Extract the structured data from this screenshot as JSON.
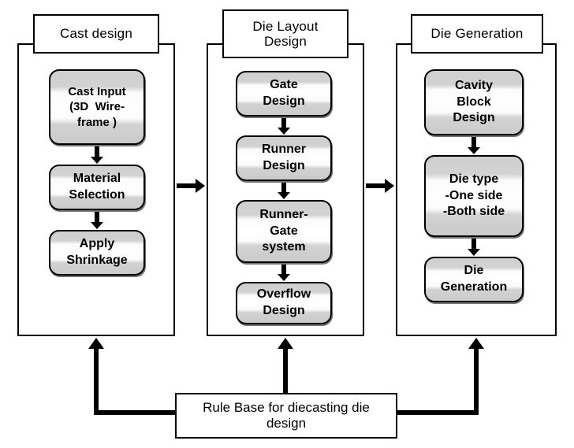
{
  "diagram": {
    "title": "Diecasting die design system flowchart",
    "phases": [
      {
        "id": "cast-design",
        "title": "Cast design",
        "steps": [
          {
            "id": "cast-input",
            "lines": [
              "Cast Input",
              "(3D  Wire-",
              "frame )"
            ]
          },
          {
            "id": "material-selection",
            "lines": [
              "Material",
              "Selection"
            ]
          },
          {
            "id": "apply-shrinkage",
            "lines": [
              "Apply",
              "Shrinkage"
            ]
          }
        ]
      },
      {
        "id": "die-layout-design",
        "title": "Die Layout\nDesign",
        "steps": [
          {
            "id": "gate-design",
            "lines": [
              "Gate",
              "Design"
            ]
          },
          {
            "id": "runner-design",
            "lines": [
              "Runner",
              "Design"
            ]
          },
          {
            "id": "runner-gate-system",
            "lines": [
              "Runner-",
              "Gate",
              "system"
            ]
          },
          {
            "id": "overflow-design",
            "lines": [
              "Overflow",
              "Design"
            ]
          }
        ]
      },
      {
        "id": "die-generation",
        "title": "Die Generation",
        "steps": [
          {
            "id": "cavity-block-design",
            "lines": [
              "Cavity",
              "Block",
              "Design"
            ]
          },
          {
            "id": "die-type",
            "lines": [
              "Die type",
              "-One side",
              "-Both side"
            ]
          },
          {
            "id": "die-generation-step",
            "lines": [
              "Die",
              "Generation"
            ]
          }
        ]
      }
    ],
    "rule_base": {
      "id": "rule-base",
      "label": "Rule Base for diecasting die\ndesign"
    },
    "colors": {
      "stroke": "#000000",
      "page_background": "#ffffff",
      "box_fill": "#ffffff",
      "process_shade": "#d0d0d0"
    }
  }
}
